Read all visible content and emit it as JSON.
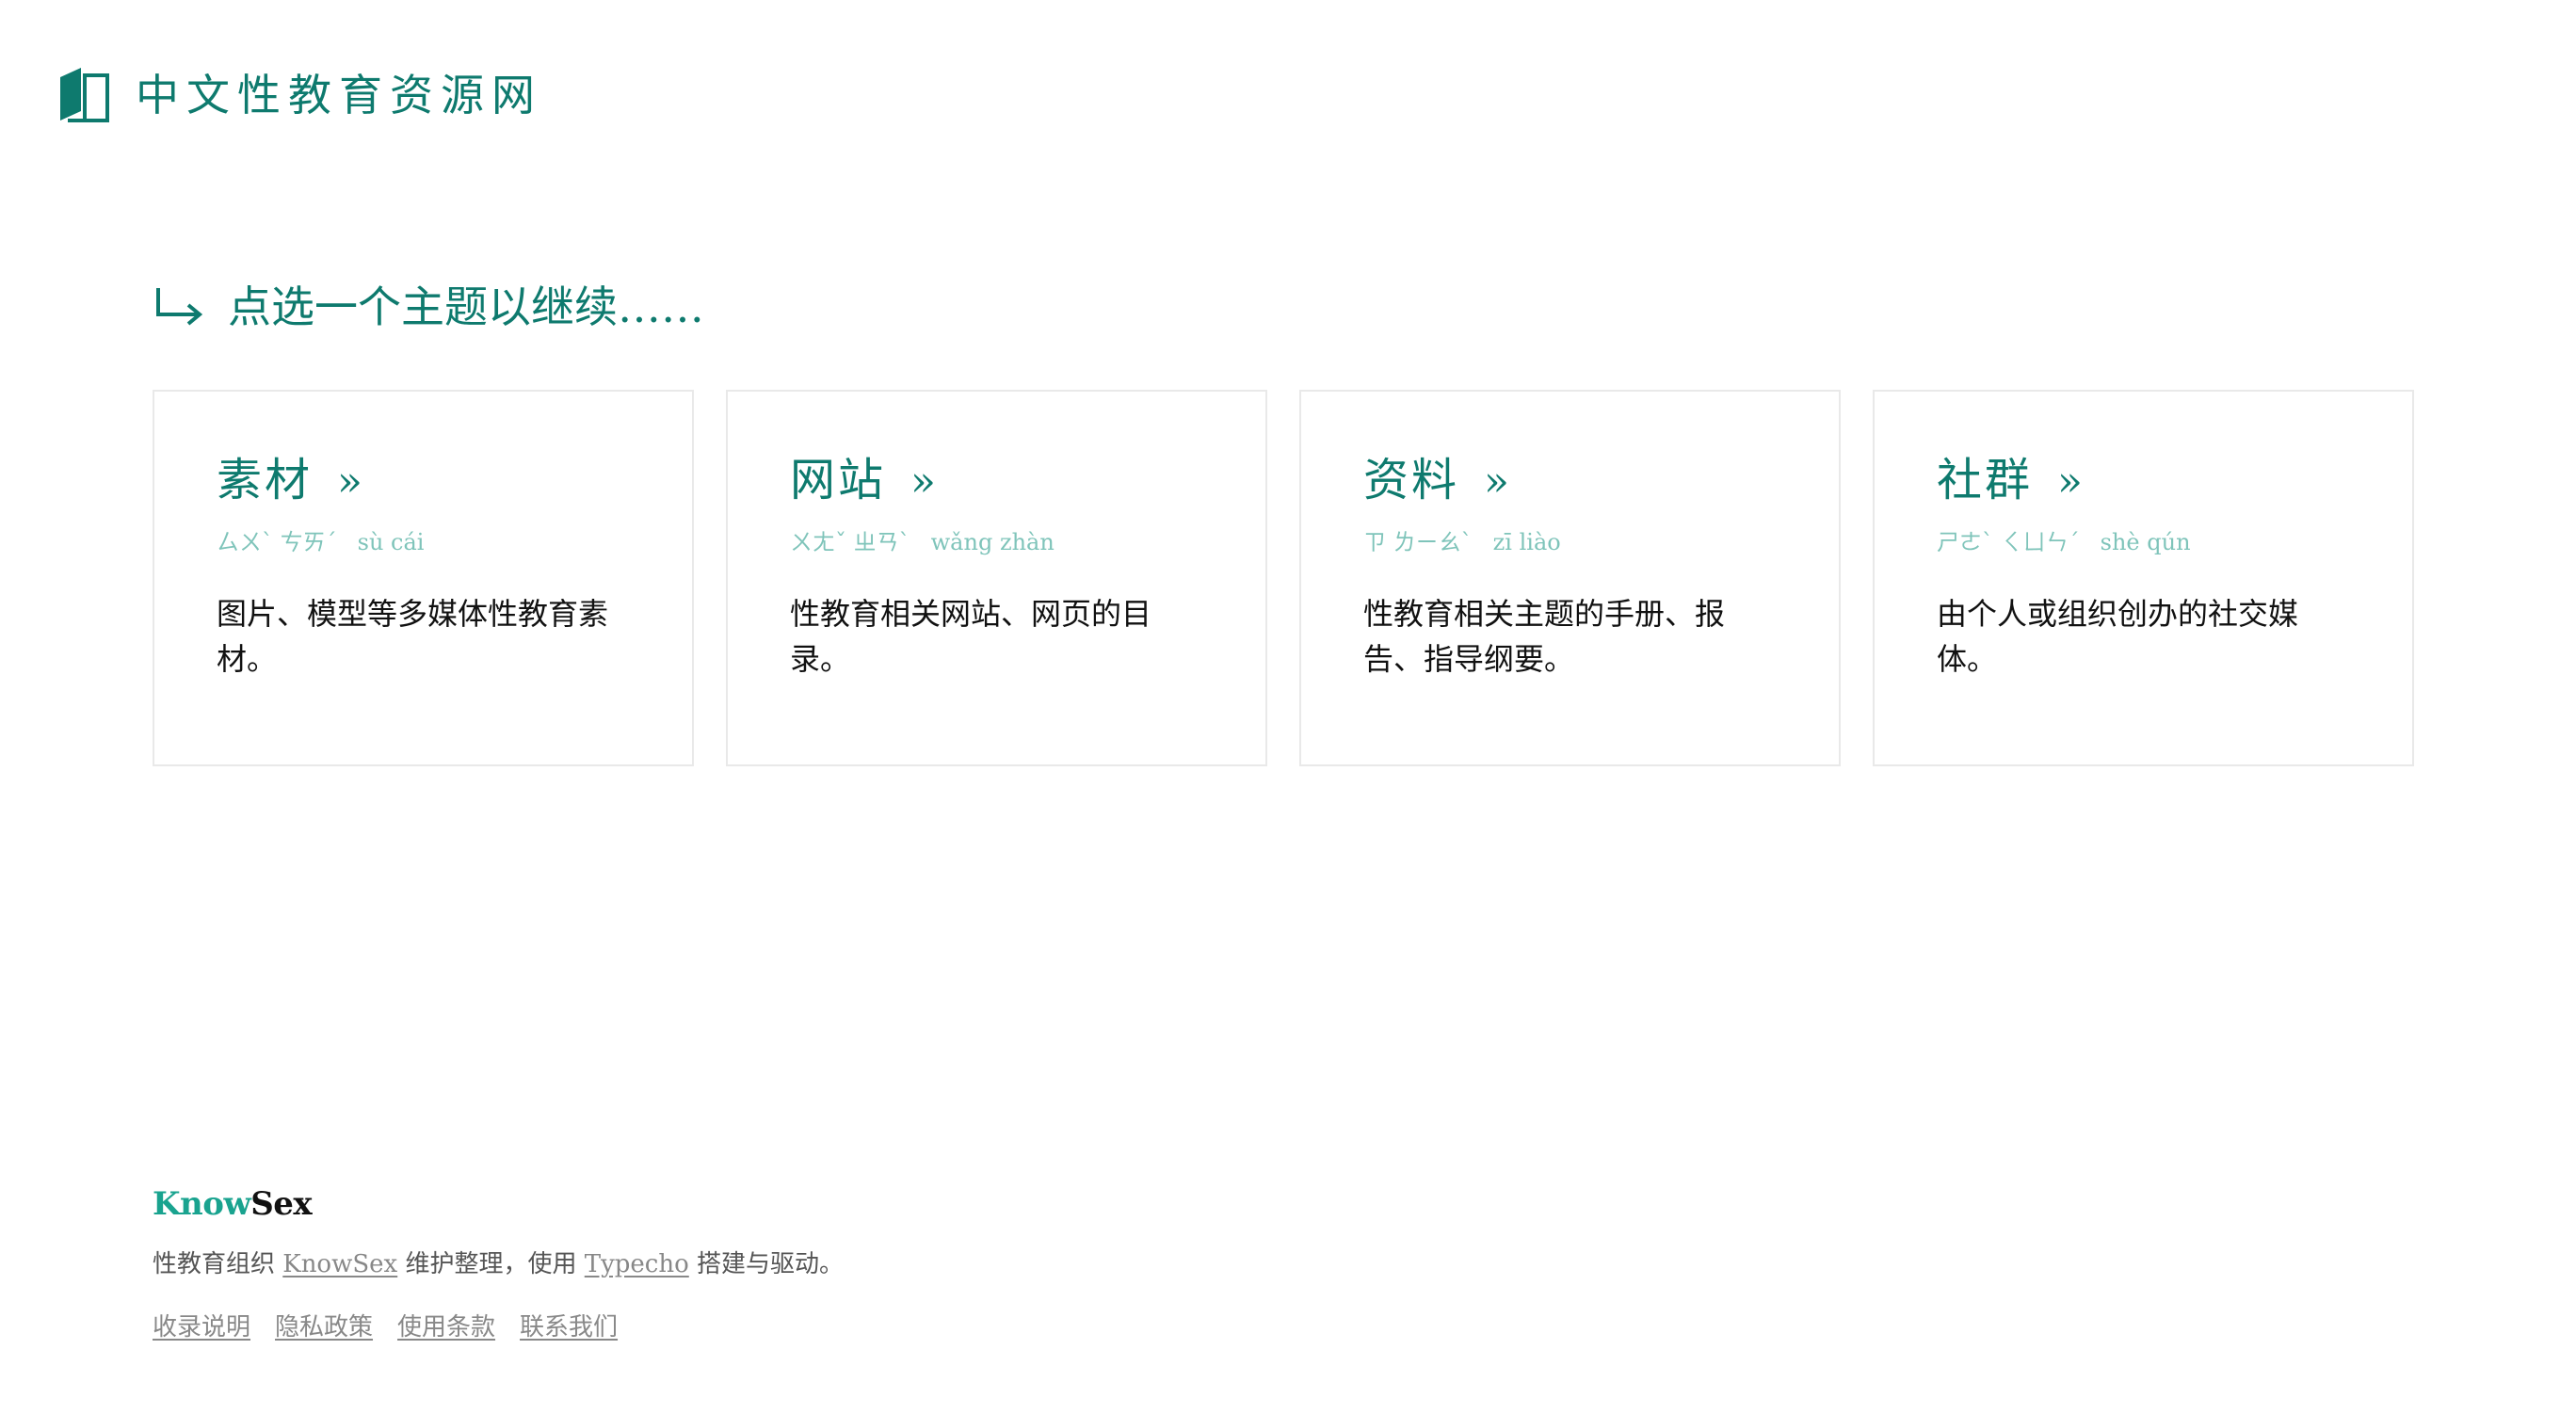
{
  "header": {
    "logo_icon": "open-book-icon",
    "site_title": "中文性教育资源网",
    "accent_color": "#0e7a6e"
  },
  "prompt": {
    "icon": "return-arrow-icon",
    "text": "点选一个主题以继续……"
  },
  "cards": [
    {
      "title": "素材",
      "chevron": "»",
      "zhuyin": "ㄙㄨˋ ㄘㄞˊ",
      "pinyin": "sù cái",
      "description": "图片、模型等多媒体性教育素材。"
    },
    {
      "title": "网站",
      "chevron": "»",
      "zhuyin": "ㄨㄤˇ ㄓㄢˋ",
      "pinyin": "wǎng zhàn",
      "description": "性教育相关网站、网页的目录。"
    },
    {
      "title": "资料",
      "chevron": "»",
      "zhuyin": "ㄗ ㄌㄧㄠˋ",
      "pinyin": "zī liào",
      "description": "性教育相关主题的手册、报告、指导纲要。"
    },
    {
      "title": "社群",
      "chevron": "»",
      "zhuyin": "ㄕㄜˋ ㄑㄩㄣˊ",
      "pinyin": "shè qún",
      "description": "由个人或组织创办的社交媒体。"
    }
  ],
  "footer": {
    "brand_part1": "Know",
    "brand_part2": "Sex",
    "brand_color": "#19a38f",
    "credit_prefix": "性教育组织 ",
    "credit_link1": "KnowSex",
    "credit_middle": " 维护整理，使用 ",
    "credit_link2": "Typecho",
    "credit_suffix": " 搭建与驱动。",
    "links": [
      "收录说明",
      "隐私政策",
      "使用条款",
      "联系我们"
    ]
  }
}
